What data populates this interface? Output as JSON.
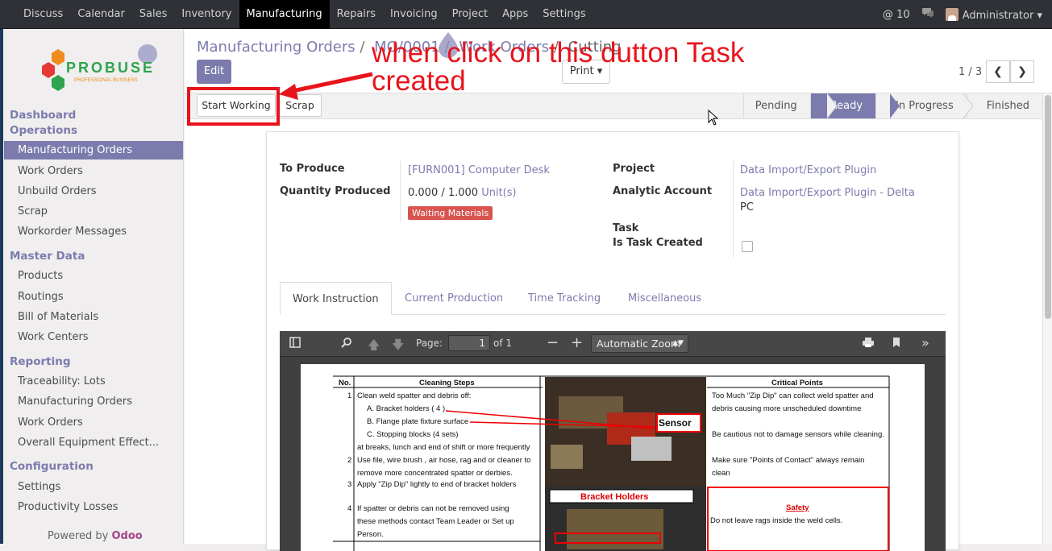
{
  "topbar": {
    "menu": [
      "Discuss",
      "Calendar",
      "Sales",
      "Inventory",
      "Manufacturing",
      "Repairs",
      "Invoicing",
      "Project",
      "Apps",
      "Settings"
    ],
    "active": "Manufacturing",
    "notifications": "@ 10",
    "user": "Administrator"
  },
  "sidebar": {
    "logo": {
      "text": "PROBUSE",
      "tagline": "PROFESSIONAL BUSINESS"
    },
    "sections": {
      "dashboard": "Dashboard",
      "operations": "Operations",
      "master_data": "Master Data",
      "reporting": "Reporting",
      "configuration": "Configuration"
    },
    "operations": [
      "Manufacturing Orders",
      "Work Orders",
      "Unbuild Orders",
      "Scrap",
      "Workorder Messages"
    ],
    "master_data": [
      "Products",
      "Routings",
      "Bill of Materials",
      "Work Centers"
    ],
    "reporting": [
      "Traceability: Lots",
      "Manufacturing Orders",
      "Work Orders",
      "Overall Equipment Effect..."
    ],
    "configuration": [
      "Settings",
      "Productivity Losses"
    ],
    "powered_by": "Powered by",
    "powered_brand": "Odoo"
  },
  "breadcrumb": {
    "items": [
      "Manufacturing Orders",
      "MO/0001",
      "Work Orders",
      "Cutting"
    ],
    "sep": "/"
  },
  "buttons": {
    "edit": "Edit",
    "print": "Print ▾",
    "start_working": "Start Working",
    "scrap": "Scrap"
  },
  "pager": {
    "text": "1 / 3"
  },
  "annotation": "when click on this dutton Task\ncreated",
  "stages": [
    "Pending",
    "Ready",
    "In Progress",
    "Finished"
  ],
  "current_stage": "Ready",
  "form": {
    "to_produce_label": "To Produce",
    "to_produce_value": "[FURN001] Computer Desk",
    "qty_label": "Quantity Produced",
    "qty_value": "0.000  /  1.000",
    "qty_unit": "Unit(s)",
    "badge": "Waiting Materials",
    "project_label": "Project",
    "project_value": "Data Import/Export Plugin",
    "analytic_label": "Analytic Account",
    "analytic_value": "Data Import/Export Plugin - Delta",
    "analytic_value2": "PC",
    "task_label": "Task",
    "is_task_created_label": "Is Task Created",
    "is_task_created": false
  },
  "tabs": [
    "Work Instruction",
    "Current Production",
    "Time Tracking",
    "Miscellaneous"
  ],
  "active_tab": "Work Instruction",
  "pdf": {
    "page_label": "Page:",
    "page_value": "1",
    "of_pages": "of 1",
    "zoom": "Automatic Zoom",
    "doc": {
      "col_no": "No.",
      "col_steps": "Cleaning Steps",
      "col_points": "Critical Points",
      "steps": [
        {
          "no": "1",
          "text": "Clean weld spatter and debris off:"
        },
        {
          "no": "",
          "text": "A. Bracket holders ( 4 )"
        },
        {
          "no": "",
          "text": "B. Flange plate fixture surface"
        },
        {
          "no": "",
          "text": "C. Stopping blocks (4 sets)"
        },
        {
          "no": "",
          "text": "at breaks, lunch and end of shift or more frequently"
        },
        {
          "no": "2",
          "text": "Use file, wire brush , air hose, rag and or cleaner to"
        },
        {
          "no": "",
          "text": "remove more concentrated spatter or derbies."
        },
        {
          "no": "3",
          "text": "Apply \"Zip Dip\" lightly to end of bracket holders"
        },
        {
          "no": "4",
          "text": "If spatter or debris can not be removed using"
        },
        {
          "no": "",
          "text": "these methods contact Team Leader or Set up"
        },
        {
          "no": "",
          "text": "Person."
        }
      ],
      "points": [
        "Too Much \"Zip Dip\" can collect weld spatter and",
        "debris causing more unscheduled downtime",
        "Be cautious not to damage sensors while cleaning.",
        "Make sure \"Points of Contact\" always remain",
        "clean"
      ],
      "sensor_label": "Sensor",
      "bracket_label": "Bracket Holders",
      "safety_title": "Safety",
      "safety_text": "Do not leave rags inside the weld cells."
    }
  },
  "colors": {
    "primary": "#7c7bad",
    "topbar": "#2f3136",
    "danger": "#d9534f",
    "annotation": "#e8141c"
  }
}
